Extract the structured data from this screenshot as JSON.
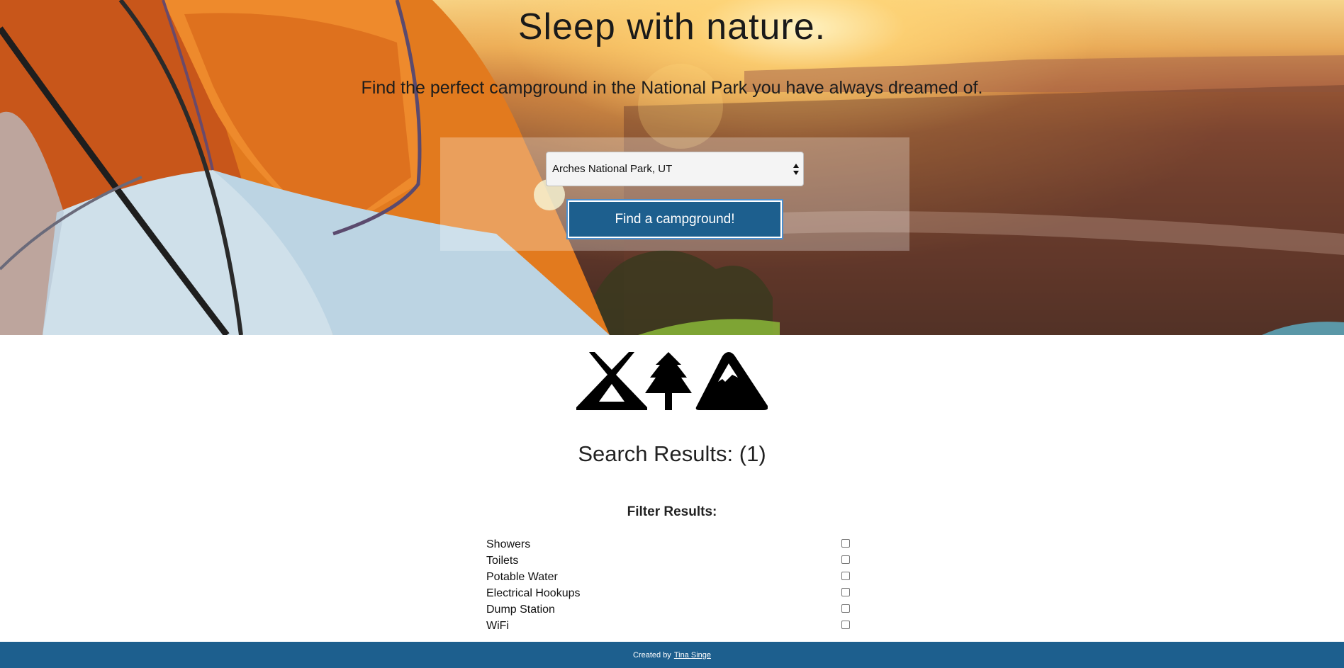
{
  "hero": {
    "title": "Sleep with nature.",
    "subtitle": "Find the perfect campground in the National Park you have always dreamed of."
  },
  "search": {
    "selected_park": "Arches National Park, UT",
    "button_label": "Find a campground!"
  },
  "icons": [
    "tent-icon",
    "tree-icon",
    "mountain-icon"
  ],
  "results": {
    "title": "Search Results: (1)"
  },
  "filters": {
    "title": "Filter Results:",
    "items": [
      {
        "label": "Showers",
        "checked": false
      },
      {
        "label": "Toilets",
        "checked": false
      },
      {
        "label": "Potable Water",
        "checked": false
      },
      {
        "label": "Electrical Hookups",
        "checked": false
      },
      {
        "label": "Dump Station",
        "checked": false
      },
      {
        "label": "WiFi",
        "checked": false
      }
    ]
  },
  "footer": {
    "prefix": "Created by",
    "author": "Tina Singe"
  },
  "colors": {
    "brand_blue": "#1d5f8e",
    "button_outline": "#4c8fce"
  }
}
